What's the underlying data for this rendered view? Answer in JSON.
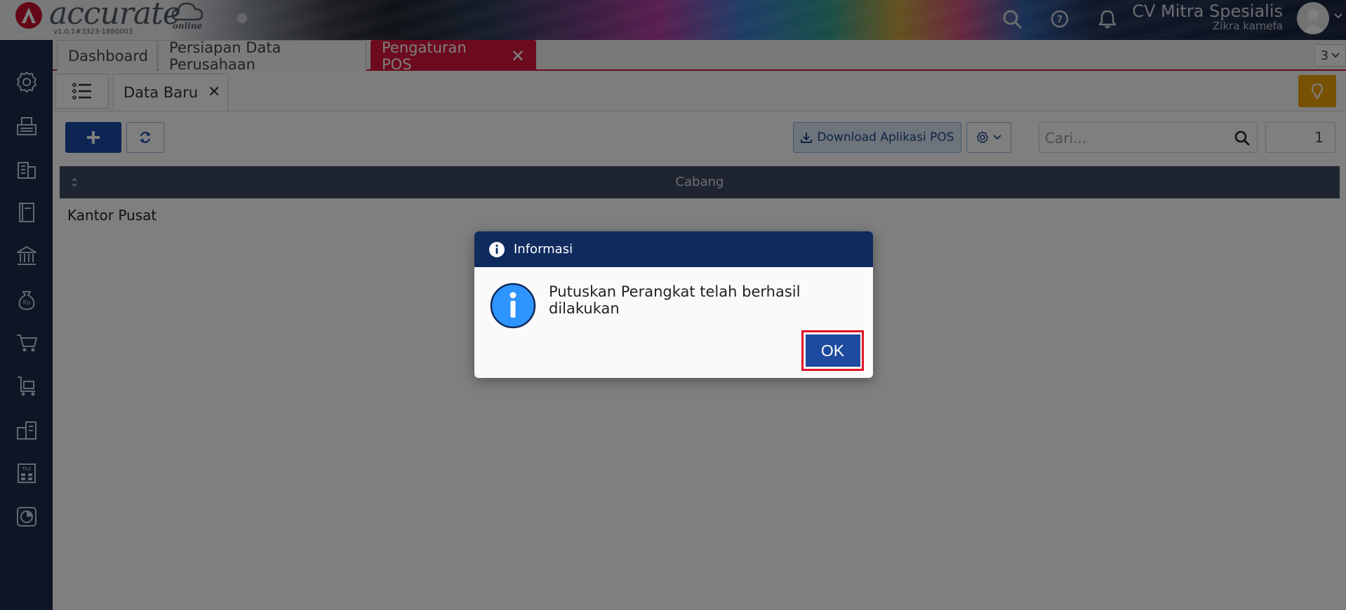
{
  "header": {
    "brand_name": "accurate",
    "brand_suffix": "online",
    "version": "v1.0.1#3323-1880003",
    "company_name": "CV Mitra Spesialis",
    "user_name": "Zikra karnefa"
  },
  "tabs": [
    {
      "label": "Dashboard"
    },
    {
      "label": "Persiapan Data Perusahaan"
    },
    {
      "label": "Pengaturan POS"
    }
  ],
  "tab_count": "3",
  "subtab": {
    "label": "Data Baru"
  },
  "toolbar": {
    "download_label": "Download Aplikasi POS",
    "search_placeholder": "Cari...",
    "page_number": "1"
  },
  "grid": {
    "column": "Cabang",
    "rows": [
      {
        "cabang": "Kantor Pusat"
      }
    ]
  },
  "dialog": {
    "title": "Informasi",
    "message": "Putuskan Perangkat telah berhasil dilakukan",
    "ok_label": "OK"
  },
  "colors": {
    "accent_red": "#d8163c",
    "primary_blue": "#1c4aa8",
    "dialog_header": "#0f2a5c",
    "sidebar": "#1c2a4a",
    "tip_orange": "#f0a30a"
  }
}
